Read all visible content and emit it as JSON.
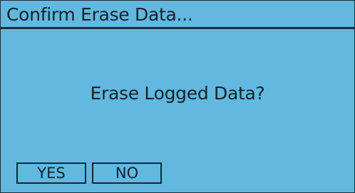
{
  "dialog": {
    "title": "Confirm Erase Data...",
    "message": "Erase Logged Data?",
    "yes_label": "YES",
    "no_label": "NO"
  },
  "colors": {
    "background": "#62b8de",
    "text": "#14222c",
    "border": "#1a2630"
  }
}
